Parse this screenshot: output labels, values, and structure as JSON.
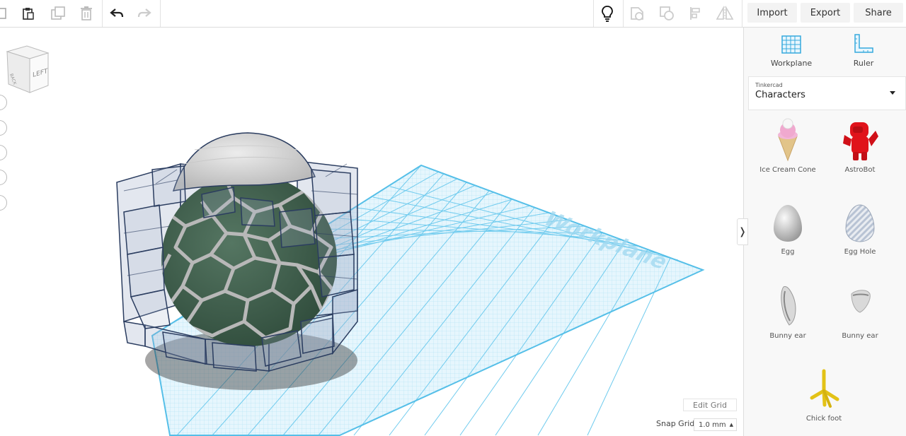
{
  "toolbar": {
    "import_label": "Import",
    "export_label": "Export",
    "share_label": "Share"
  },
  "viewcube": {
    "face_label": "LEFT",
    "side_label": "BACK"
  },
  "workplane_text": "Workplane",
  "viewport": {
    "edit_grid_label": "Edit Grid",
    "snap_grid_label": "Snap Grid",
    "snap_grid_value": "1.0 mm"
  },
  "panel": {
    "workplane_label": "Workplane",
    "ruler_label": "Ruler",
    "library_provider": "Tinkercad",
    "library_name": "Characters",
    "shapes": [
      {
        "label": "Ice Cream Cone"
      },
      {
        "label": "AstroBot"
      },
      {
        "label": "Egg"
      },
      {
        "label": "Egg Hole"
      },
      {
        "label": "Bunny ear"
      },
      {
        "label": "Bunny ear"
      },
      {
        "label": "Chick foot"
      }
    ]
  },
  "colors": {
    "grid_blue": "#5cc5ea",
    "egg_green": "#3d5c4a",
    "egg_cap": "#d4d4d4",
    "astrobot_red": "#e0131b",
    "chick_foot_yellow": "#e3c217"
  }
}
